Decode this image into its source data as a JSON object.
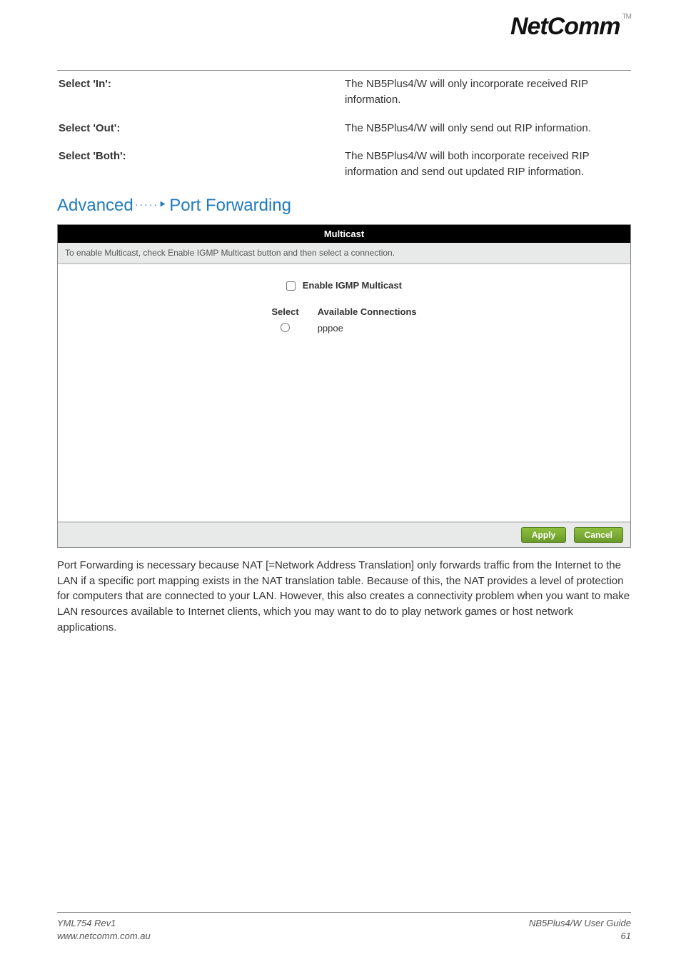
{
  "brand": {
    "name": "NetComm",
    "tm": "TM"
  },
  "defs": [
    {
      "term": "Select 'In':",
      "desc": "The NB5Plus4/W will only incorporate received RIP information."
    },
    {
      "term": "Select 'Out':",
      "desc": "The NB5Plus4/W will only send out RIP information."
    },
    {
      "term": "Select 'Both':",
      "desc": "The NB5Plus4/W will both incorporate received RIP information and send out updated RIP information."
    }
  ],
  "section": {
    "prefix": "Advanced",
    "arrow": "·····⯈",
    "title": "Port Forwarding"
  },
  "panel": {
    "header": "Multicast",
    "instruction": "To enable Multicast, check Enable IGMP Multicast button and then select a connection.",
    "enable_label": "Enable IGMP Multicast",
    "col_select": "Select",
    "col_conn": "Available Connections",
    "rows": [
      {
        "name": "pppoe"
      }
    ],
    "apply": "Apply",
    "cancel": "Cancel"
  },
  "body_text": "Port Forwarding is necessary because NAT [=Network Address Translation] only forwards traffic from the Internet to the LAN if a specific port mapping exists in the NAT translation table. Because of this, the NAT provides a level of protection for computers that are connected to your LAN. However, this also creates a connectivity problem when you want to make LAN resources available to Internet clients, which you may want to do to play network games or host network applications.",
  "footer": {
    "left1": "YML754 Rev1",
    "left2": "www.netcomm.com.au",
    "right1": "NB5Plus4/W User Guide",
    "right2": "61"
  }
}
